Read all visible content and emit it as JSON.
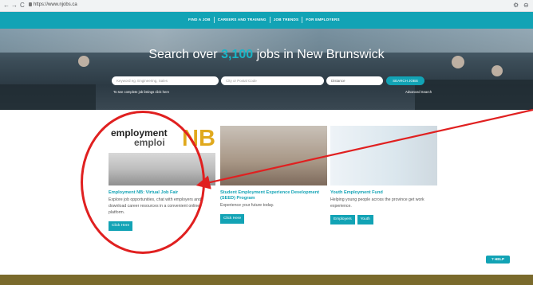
{
  "browser": {
    "back_icon": "←",
    "forward_icon": "→",
    "reload_icon": "C",
    "url": "https://www.njobs.ca",
    "settings_icon": "⚙",
    "account_icon": "⊖"
  },
  "nav": {
    "items": [
      "FIND A JOB",
      "CAREERS AND TRAINING",
      "JOB TRENDS",
      "FOR EMPLOYERS"
    ]
  },
  "hero": {
    "title_prefix": "Search over ",
    "job_count": "3,100",
    "title_suffix": " jobs in New Brunswick",
    "keyword_placeholder": "Keyword eg. Engineering, Sales",
    "location_placeholder": "City or Postal Code",
    "distance_value": "Distance",
    "search_button": "SEARCH JOBS",
    "listings_note": "To see complete job listings click here",
    "advanced_search": "Advanced Search"
  },
  "cards": [
    {
      "image_text_1": "employment",
      "image_text_2": "emploi",
      "image_text_nb": "NB",
      "title": "Employment NB: Virtual Job Fair",
      "description": "Explore job opportunities, chat with employers and download career resources in a convenient online platform.",
      "buttons": [
        "Click Here"
      ]
    },
    {
      "title": "Student Employment Experience Development (SEED) Program",
      "description": "Experience your future today.",
      "buttons": [
        "Click Here"
      ]
    },
    {
      "title": "Youth Employment Fund",
      "description": "Helping young people across the province get work experience.",
      "buttons": [
        "Employers",
        "Youth"
      ]
    }
  ],
  "help": {
    "label": "HELP"
  },
  "colors": {
    "accent": "#12a3b5",
    "annotation": "#e02020",
    "footer": "#7a6a2c"
  }
}
